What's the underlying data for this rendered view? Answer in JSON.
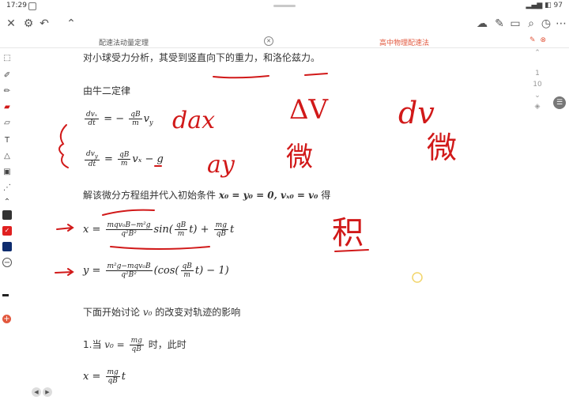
{
  "status": {
    "time": "17:29",
    "battery": "97"
  },
  "tabs": [
    {
      "label": "配速法动量定理"
    },
    {
      "label": "高中物理配速法"
    }
  ],
  "pager": {
    "current": "1",
    "total": "10"
  },
  "doc": {
    "intro": "对小球受力分析，其受到竖直向下的重力，和洛伦兹力。",
    "newton": "由牛二定律",
    "solve_text": "解该微分方程组并代入初始条件",
    "solve_cond": "x₀ = y₀ = 0, vₓ₀ = v₀",
    "solve_end": "得",
    "discuss": "下面开始讨论",
    "discuss_var": "v₀",
    "discuss_end": "的改变对轨迹的影响",
    "case1_pre": "1.当",
    "case1_post": "时，此时",
    "eq1": {
      "num_left": "dvₓ",
      "den": "dt",
      "mid": "= −",
      "q_num": "qB",
      "q_den": "m",
      "tail": "v",
      "tail_sub": "y"
    },
    "eq2": {
      "num_left": "dv",
      "num_sub": "y",
      "den": "dt",
      "mid": "=",
      "q_num": "qB",
      "q_den": "m",
      "tail": "vₓ − g"
    },
    "eqx": {
      "lhs": "x =",
      "f_num": "mqv₀B−m²g",
      "f_den": "q²B²",
      "mid": "sin(",
      "in_num": "qB",
      "in_den": "m",
      "after": "t) +",
      "g_num": "mg",
      "g_den": "qB",
      "end": "t"
    },
    "eqy": {
      "lhs": "y =",
      "f_num": "m²g−mqv₀B",
      "f_den": "q²B²",
      "mid": "(cos(",
      "in_num": "qB",
      "in_den": "m",
      "after": "t) − 1)"
    },
    "case1_eq": {
      "lhs": "v₀ =",
      "num": "mg",
      "den": "qB"
    },
    "eqlast": {
      "lhs": "x =",
      "num": "mg",
      "den": "qB",
      "end": "t"
    }
  },
  "handwriting": {
    "dax": "dax",
    "ay": "ay",
    "dv": "dv",
    "delta_v": "ΔV",
    "wei1": "微",
    "wei2": "微",
    "ji": "积"
  },
  "colors": {
    "accent": "#e2583e",
    "ink": "#d11919"
  }
}
